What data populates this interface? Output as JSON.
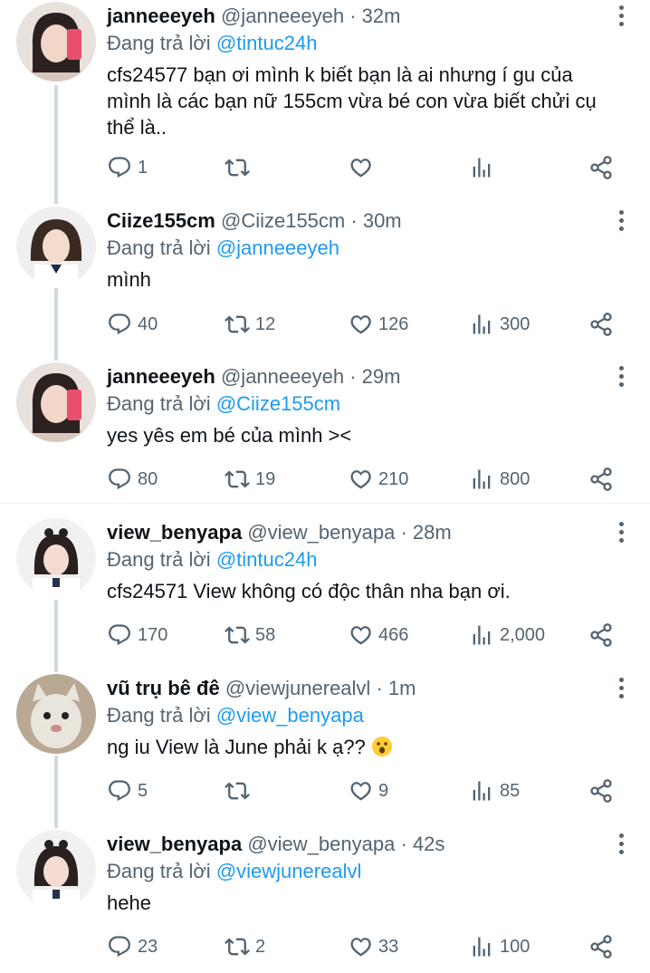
{
  "reply_prefix": "Đang trả lời",
  "tweets": [
    {
      "name": "janneeeyeh",
      "handle": "@janneeeyeh",
      "time": "32m",
      "reply_to": "@tintuc24h",
      "text": "cfs24577 bạn ơi mình k biết bạn là ai nhưng í gu của mình là các bạn nữ 155cm vừa  bé con vừa biết chửi cụ thể là..",
      "replies": "1",
      "retweets": "",
      "likes": "",
      "views": ""
    },
    {
      "name": "Ciize155cm",
      "handle": "@Ciize155cm",
      "time": "30m",
      "reply_to": "@janneeeyeh",
      "text": "mình",
      "replies": "40",
      "retweets": "12",
      "likes": "126",
      "views": "300"
    },
    {
      "name": "janneeeyeh",
      "handle": "@janneeeyeh",
      "time": "29m",
      "reply_to": "@Ciize155cm",
      "text": "yes yês em bé của mình ><",
      "replies": "80",
      "retweets": "19",
      "likes": "210",
      "views": "800"
    },
    {
      "name": "view_benyapa",
      "handle": "@view_benyapa",
      "time": "28m",
      "reply_to": "@tintuc24h",
      "text": "cfs24571 View không có độc thân nha bạn ơi.",
      "replies": "170",
      "retweets": "58",
      "likes": "466",
      "views": "2,000"
    },
    {
      "name": "vũ trụ bê đê",
      "handle": "@viewjunerealvl",
      "time": "1m",
      "reply_to": "@view_benyapa",
      "text": "ng iu View là June phải k ạ??",
      "replies": "5",
      "retweets": "",
      "likes": "9",
      "views": "85"
    },
    {
      "name": "view_benyapa",
      "handle": "@view_benyapa",
      "time": "42s",
      "reply_to": "@viewjunerealvl",
      "text": "hehe",
      "replies": "23",
      "retweets": "2",
      "likes": "33",
      "views": "100"
    }
  ]
}
